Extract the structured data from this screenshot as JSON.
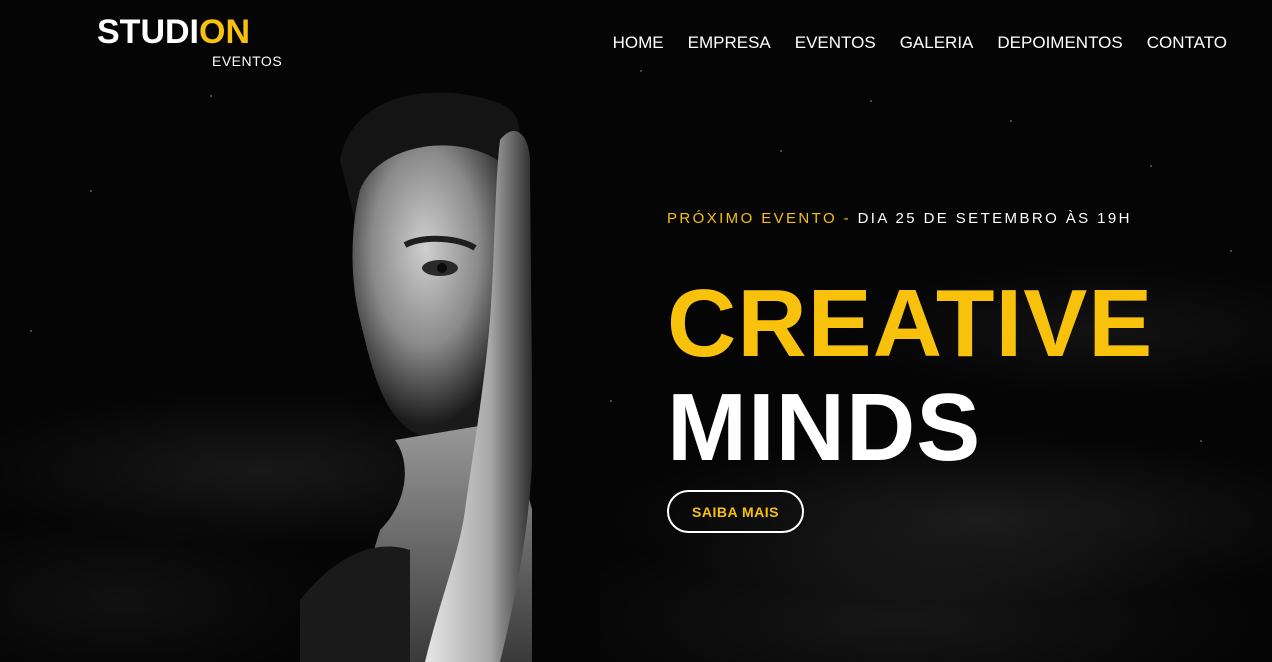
{
  "logo": {
    "main_text": "STUDI",
    "accent_text": "ON",
    "subtext": "EVENTOS"
  },
  "nav": {
    "items": [
      {
        "label": "HOME"
      },
      {
        "label": "EMPRESA"
      },
      {
        "label": "EVENTOS"
      },
      {
        "label": "GALERIA"
      },
      {
        "label": "DEPOIMENTOS"
      },
      {
        "label": "CONTATO"
      }
    ]
  },
  "hero": {
    "event_label": "PRÓXIMO EVENTO",
    "separator": "-",
    "event_date": "DIA 25 DE SETEMBRO ÀS 19H",
    "title_line1": "CREATIVE",
    "title_line2": "MINDS",
    "cta_label": "SAIBA MAIS"
  },
  "colors": {
    "accent": "#f8c10c",
    "background": "#000000",
    "text": "#ffffff"
  }
}
